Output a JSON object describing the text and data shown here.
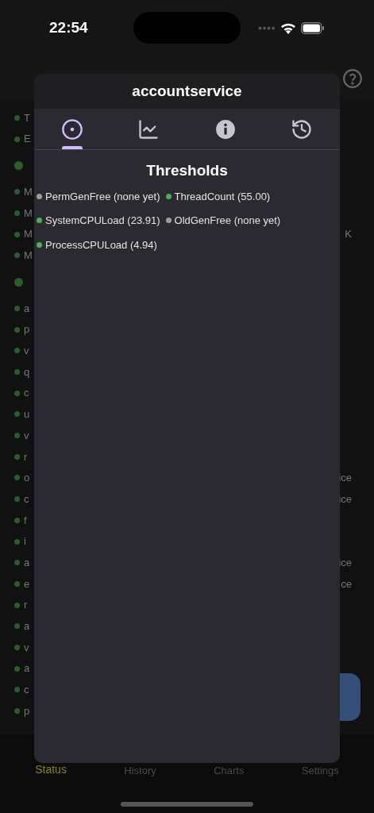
{
  "status_bar": {
    "time": "22:54"
  },
  "background": {
    "rows": [
      {
        "kind": "item",
        "left": "T"
      },
      {
        "kind": "item",
        "left": "E"
      },
      {
        "kind": "header"
      },
      {
        "kind": "item",
        "left": "M"
      },
      {
        "kind": "item",
        "left": "M"
      },
      {
        "kind": "item",
        "left": "M",
        "right": "K"
      },
      {
        "kind": "item",
        "left": "M"
      },
      {
        "kind": "header"
      },
      {
        "kind": "item",
        "left": "a"
      },
      {
        "kind": "item",
        "left": "p"
      },
      {
        "kind": "item",
        "left": "v"
      },
      {
        "kind": "item",
        "left": "q"
      },
      {
        "kind": "item",
        "left": "c"
      },
      {
        "kind": "item",
        "left": "u"
      },
      {
        "kind": "item",
        "left": "v"
      },
      {
        "kind": "item",
        "left": "r"
      },
      {
        "kind": "item",
        "left": "o",
        "right": "ice"
      },
      {
        "kind": "item",
        "left": "c",
        "right": "ice"
      },
      {
        "kind": "item",
        "left": "f"
      },
      {
        "kind": "item",
        "left": "i"
      },
      {
        "kind": "item",
        "left": "a",
        "right": "ice"
      },
      {
        "kind": "item",
        "left": "e",
        "right": "ce"
      },
      {
        "kind": "item",
        "left": "r"
      },
      {
        "kind": "item",
        "left": "a"
      },
      {
        "kind": "item",
        "left": "v"
      },
      {
        "kind": "item",
        "left": "a"
      },
      {
        "kind": "item",
        "left": "c"
      },
      {
        "kind": "item",
        "left": "p"
      }
    ]
  },
  "dialog": {
    "title": "accountservice",
    "tabs": [
      {
        "kind": "status",
        "selected": true
      },
      {
        "kind": "chart",
        "selected": false
      },
      {
        "kind": "info",
        "selected": false
      },
      {
        "kind": "history",
        "selected": false
      }
    ],
    "heading": "Thresholds",
    "thresholds": [
      {
        "label": "PermGenFree (none yet)",
        "color": "#9e9e9e"
      },
      {
        "label": "ThreadCount (55.00)",
        "color": "#4caf50"
      },
      {
        "label": "SystemCPULoad (23.91)",
        "color": "#4caf50"
      },
      {
        "label": "OldGenFree (none yet)",
        "color": "#9e9e9e"
      },
      {
        "label": "ProcessCPULoad (4.94)",
        "color": "#4caf50"
      }
    ]
  },
  "tab_bar": [
    {
      "label": "Status",
      "selected": true
    },
    {
      "label": "History",
      "selected": false
    },
    {
      "label": "Charts",
      "selected": false
    },
    {
      "label": "Settings",
      "selected": false
    }
  ]
}
